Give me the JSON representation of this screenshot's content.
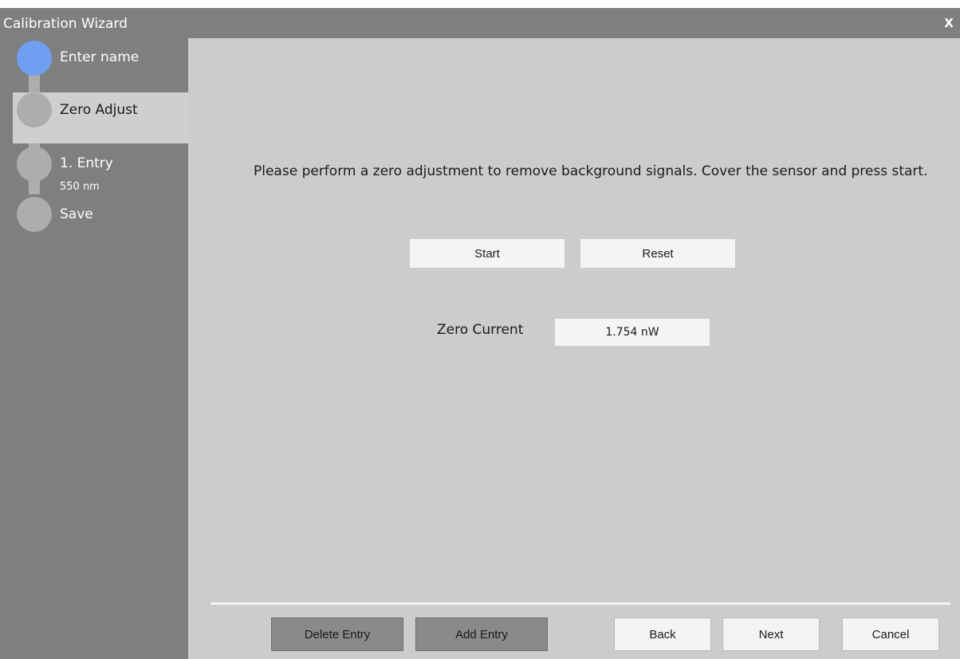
{
  "window": {
    "title": "Calibration Wizard",
    "close_label": "X"
  },
  "steps": [
    {
      "label": "Enter name",
      "sub": "",
      "state": "done"
    },
    {
      "label": "Zero Adjust",
      "sub": "",
      "state": "current"
    },
    {
      "label": "1. Entry",
      "sub": "550 nm",
      "state": "pending"
    },
    {
      "label": "Save",
      "sub": "",
      "state": "pending"
    }
  ],
  "main": {
    "instructions": "Please perform a zero adjustment to remove background signals. Cover the sensor and press start.",
    "start_label": "Start",
    "reset_label": "Reset",
    "zero_current_label": "Zero Current",
    "zero_current_value": "1.754 nW"
  },
  "footer": {
    "delete_entry_label": "Delete Entry",
    "add_entry_label": "Add Entry",
    "back_label": "Back",
    "next_label": "Next",
    "cancel_label": "Cancel"
  },
  "colors": {
    "sidebar": "#7f7f7f",
    "main_bg": "#cccccc",
    "step_done": "#6f9ff0",
    "step_pending": "#adadad",
    "button_light": "#f4f4f4",
    "button_dark": "#8a8a8a"
  }
}
